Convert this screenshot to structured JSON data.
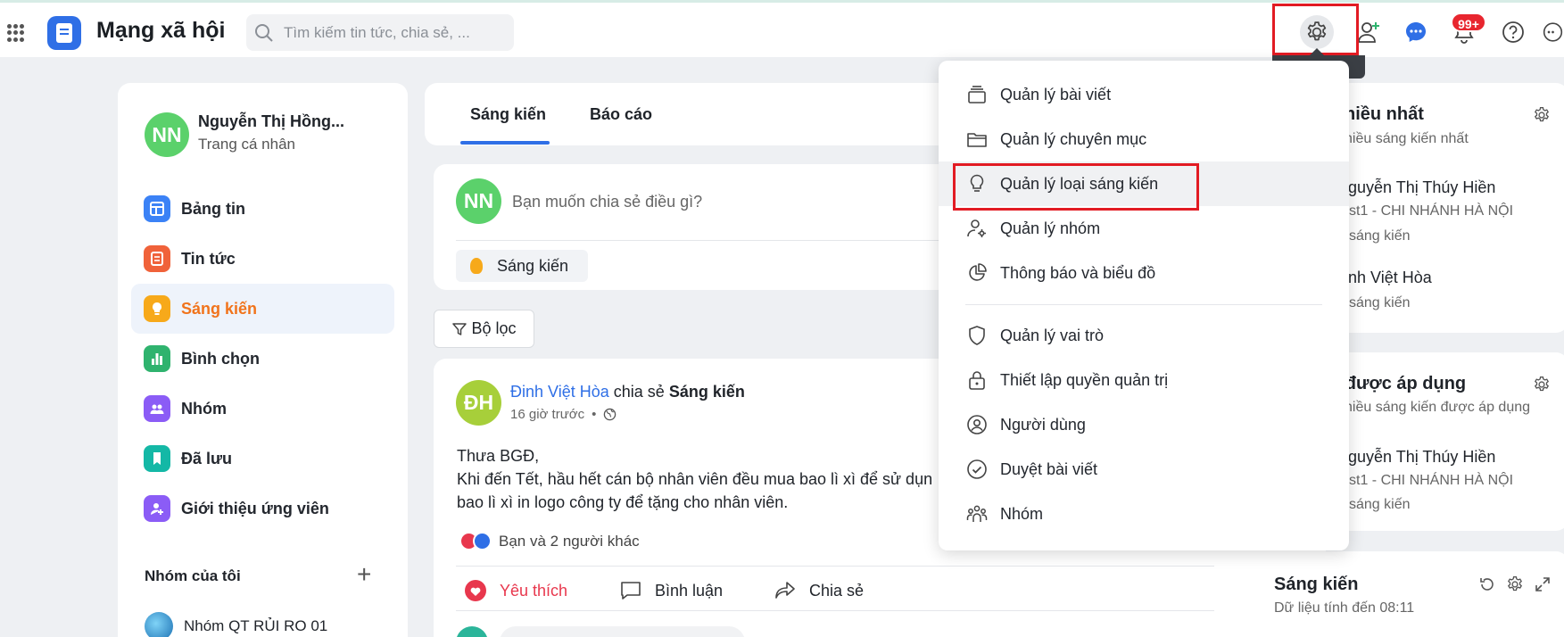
{
  "header": {
    "app_title": "Mạng xã hội",
    "search_placeholder": "Tìm kiếm tin tức, chia sẻ, ...",
    "notification_badge": "99+"
  },
  "profile": {
    "initials": "NN",
    "name": "Nguyễn Thị Hồng...",
    "subtitle": "Trang cá nhân"
  },
  "sidebar": {
    "items": [
      {
        "label": "Bảng tin",
        "icon": "newsfeed-icon",
        "color": "#3b82f6"
      },
      {
        "label": "Tin tức",
        "icon": "news-icon",
        "color": "#f0623a"
      },
      {
        "label": "Sáng kiến",
        "icon": "lightbulb-icon",
        "color": "#f7a91a"
      },
      {
        "label": "Bình chọn",
        "icon": "poll-icon",
        "color": "#2fb36e"
      },
      {
        "label": "Nhóm",
        "icon": "group-icon",
        "color": "#8b5cf6"
      },
      {
        "label": "Đã lưu",
        "icon": "bookmark-icon",
        "color": "#14b8a6"
      },
      {
        "label": "Giới thiệu ứng viên",
        "icon": "referral-icon",
        "color": "#8b5cf6"
      }
    ],
    "groups_title": "Nhóm của tôi",
    "group_name": "Nhóm QT RỦI RO 01"
  },
  "tabs": [
    "Sáng kiến",
    "Báo cáo"
  ],
  "composer": {
    "initials": "NN",
    "prompt": "Bạn muốn chia sẻ điều gì?",
    "chip_label": "Sáng kiến"
  },
  "filter_label": "Bộ lọc",
  "post": {
    "initials": "ĐH",
    "author": "Đinh Việt Hòa",
    "shared_text": "chia sẻ",
    "category": "Sáng kiến",
    "time": "16 giờ trước",
    "dot": "•",
    "body_line1": "Thưa BGĐ,",
    "body_line2": "Khi đến Tết, hầu hết cán bộ nhân viên đều mua bao lì xì để sử dụn",
    "body_line3": "bao lì xì in logo công ty để tặng cho nhân viên.",
    "reactions_text": "Bạn và 2 người khác",
    "actions": {
      "like": "Yêu thích",
      "comment": "Bình luận",
      "share": "Chia sẻ"
    }
  },
  "right_panel": {
    "card1": {
      "title": "p nhiều nhất",
      "subtitle": "hiều sáng kiến nhất",
      "entries": [
        {
          "name": "guyễn Thị Thúy Hiền",
          "line2": "st1 - CHI NHÁNH HÀ NỘI",
          "line3": "sáng kiến"
        },
        {
          "name": "nh Việt Hòa",
          "line2": "",
          "line3": "sáng kiến"
        }
      ]
    },
    "card2": {
      "title": "n được áp dụng",
      "subtitle": "hiều sáng kiến được áp dụng",
      "entries": [
        {
          "name": "guyễn Thị Thúy Hiền",
          "line2": "st1 - CHI NHÁNH HÀ NỘI",
          "line3": "sáng kiến"
        }
      ]
    },
    "card3": {
      "title": "Sáng kiến",
      "subtitle": "Dữ liệu tính đến 08:11"
    }
  },
  "settings_menu": {
    "items": [
      {
        "label": "Quản lý bài viết",
        "icon": "posts-stack-icon"
      },
      {
        "label": "Quản lý chuyên mục",
        "icon": "folder-icon"
      },
      {
        "label": "Quản lý loại sáng kiến",
        "icon": "lightbulb-outline-icon"
      },
      {
        "label": "Quản lý nhóm",
        "icon": "user-gear-icon"
      },
      {
        "label": "Thông báo và biểu đồ",
        "icon": "pie-chart-icon"
      },
      {
        "label": "Quản lý vai trò",
        "icon": "shield-icon"
      },
      {
        "label": "Thiết lập quyền quản trị",
        "icon": "lock-icon"
      },
      {
        "label": "Người dùng",
        "icon": "user-circle-icon"
      },
      {
        "label": "Duyệt bài viết",
        "icon": "check-circle-icon"
      },
      {
        "label": "Nhóm",
        "icon": "people-group-icon"
      }
    ],
    "hovered_item": "Quản lý loại sáng kiến"
  },
  "colors": {
    "accent": "#2f6fe6",
    "active_nav": "#f1731b",
    "highlight_box": "#e21b23",
    "like": "#e8374d"
  }
}
